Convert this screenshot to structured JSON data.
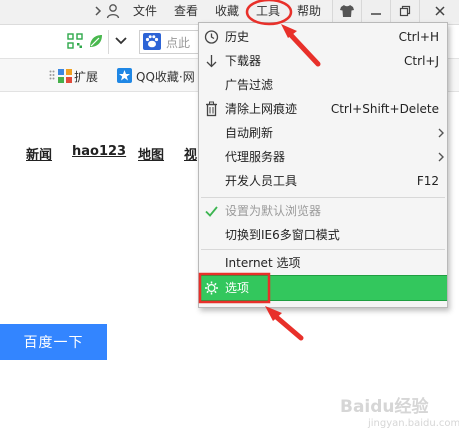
{
  "menubar": {
    "items": [
      "文件",
      "查看",
      "收藏",
      "工具",
      "帮助"
    ]
  },
  "search": {
    "placeholder": "点此"
  },
  "favorites": {
    "extensions_label": "扩展",
    "qq_favorites_label": "QQ收藏·网"
  },
  "page": {
    "nav_links": [
      "新闻",
      "hao123",
      "地图",
      "视"
    ],
    "search_button": "百度一下"
  },
  "tools_menu": {
    "items": [
      {
        "label": "历史",
        "shortcut": "Ctrl+H",
        "icon": "clock-icon"
      },
      {
        "label": "下载器",
        "shortcut": "Ctrl+J",
        "icon": "download-arrow-icon"
      },
      {
        "label": "广告过滤",
        "shortcut": ""
      },
      {
        "label": "清除上网痕迹",
        "shortcut": "Ctrl+Shift+Delete",
        "icon": "trash-icon"
      },
      {
        "label": "自动刷新",
        "shortcut": "",
        "submenu": true
      },
      {
        "label": "代理服务器",
        "shortcut": "",
        "submenu": true
      },
      {
        "label": "开发人员工具",
        "shortcut": "F12"
      },
      {
        "label": "设置为默认浏览器",
        "shortcut": "",
        "disabled": true,
        "icon": "checkmark-icon"
      },
      {
        "label": "切换到IE6多窗口模式",
        "shortcut": ""
      },
      {
        "label": "Internet 选项",
        "shortcut": ""
      },
      {
        "label": "选项",
        "shortcut": "",
        "selected": true,
        "icon": "gear-icon"
      }
    ]
  },
  "watermark": {
    "text": "Baidu经验",
    "subtext": "jingyan.baidu.com"
  },
  "colors": {
    "selected_item": "#33c75d",
    "annotation": "#e8302a",
    "search_button": "#3385ff"
  }
}
